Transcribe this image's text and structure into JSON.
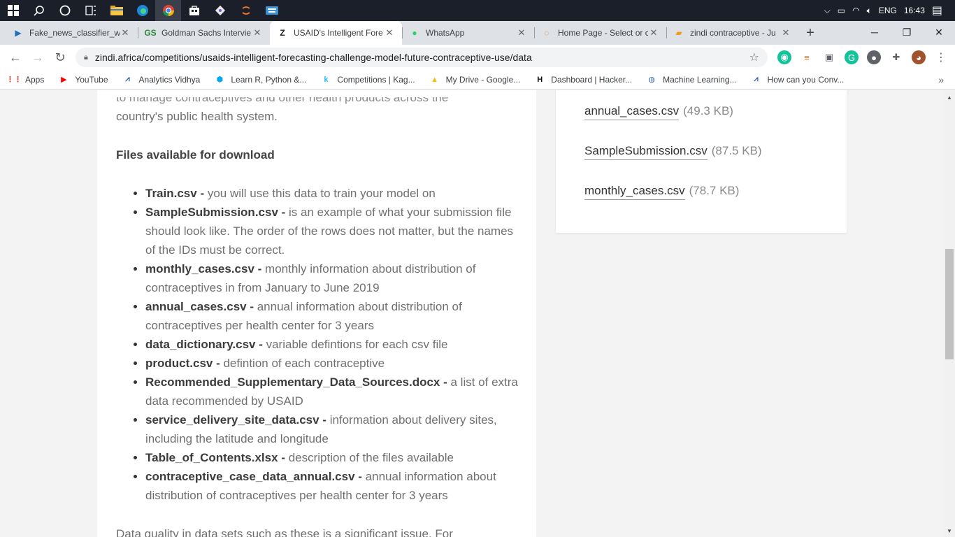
{
  "taskbar": {
    "icons": [
      "windows-start-icon",
      "search-icon",
      "cortana-icon",
      "task-view-icon",
      "file-explorer-icon",
      "edge-icon",
      "chrome-icon",
      "store-icon",
      "git-icon",
      "jupyter-icon",
      "keyboard-icon"
    ],
    "tray": {
      "language": "ENG",
      "time": "16:43"
    }
  },
  "tabs": [
    {
      "title": "Fake_news_classifier_wi",
      "favicon_color": "#1f6fbf",
      "favicon": "▶",
      "active": false
    },
    {
      "title": "Goldman Sachs Intervie",
      "favicon_color": "#2e8b3a",
      "favicon": "GS",
      "active": false
    },
    {
      "title": "USAID's Intelligent Fore",
      "favicon_color": "#202124",
      "favicon": "Z",
      "active": true
    },
    {
      "title": "WhatsApp",
      "favicon_color": "#25d366",
      "favicon": "●",
      "active": false
    },
    {
      "title": "Home Page - Select or c",
      "favicon_color": "#e8743b",
      "favicon": "◌",
      "active": false
    },
    {
      "title": "zindi contraceptive - Ju",
      "favicon_color": "#f39c12",
      "favicon": "▰",
      "active": false
    }
  ],
  "toolbar": {
    "url": "zindi.africa/competitions/usaids-intelligent-forecasting-challenge-model-future-contraceptive-use/data"
  },
  "bookmarks": [
    {
      "label": "Apps",
      "icon": "apps-grid-icon",
      "color": "#ea4335",
      "glyph": "⋮⋮"
    },
    {
      "label": "YouTube",
      "icon": "youtube-icon",
      "color": "#ff0000",
      "glyph": "▶"
    },
    {
      "label": "Analytics Vidhya",
      "icon": "analytics-vidhya-icon",
      "color": "#2a5caa",
      "glyph": "⩘"
    },
    {
      "label": "Learn R, Python &...",
      "icon": "datacamp-icon",
      "color": "#03a9f4",
      "glyph": "⬢"
    },
    {
      "label": "Competitions | Kag...",
      "icon": "kaggle-icon",
      "color": "#20beff",
      "glyph": "k"
    },
    {
      "label": "My Drive - Google...",
      "icon": "google-drive-icon",
      "color": "#fbbc04",
      "glyph": "▲"
    },
    {
      "label": "Dashboard | Hacker...",
      "icon": "hackerrank-icon",
      "color": "#111111",
      "glyph": "H"
    },
    {
      "label": "Machine Learning...",
      "icon": "ml-globe-icon",
      "color": "#4a6fa5",
      "glyph": "◍"
    },
    {
      "label": "How can you Conv...",
      "icon": "analytics-vidhya-icon",
      "color": "#2a5caa",
      "glyph": "⩘"
    }
  ],
  "main": {
    "intro_clipped": "to manage contraceptives and other health products across the",
    "intro_last": "country's public health system.",
    "files_heading": "Files available for download",
    "files": [
      {
        "name": "Train.csv",
        "sep": " - ",
        "desc": "you will use this data to train your model on"
      },
      {
        "name": "SampleSubmission.csv",
        "sep": " - ",
        "desc": "is an example of what your submission file should look like. The order of the rows does not matter, but the names of the IDs must be correct."
      },
      {
        "name": "monthly_cases.csv",
        "sep": " - ",
        "desc": "monthly information about distribution of contraceptives in from January to June 2019"
      },
      {
        "name": "annual_cases.csv",
        "sep": " - ",
        "desc": "annual information about distribution of contraceptives per health center for 3 years"
      },
      {
        "name": "data_dictionary.csv",
        "sep": " - ",
        "desc": "variable defintions for each csv file"
      },
      {
        "name": "product.csv",
        "sep": " - ",
        "desc": "defintion of each contraceptive"
      },
      {
        "name": "Recommended_Supplementary_Data_Sources.docx",
        "sep": " - ",
        "desc": "a list of extra data recommended by USAID"
      },
      {
        "name": "service_delivery_site_data.csv",
        "sep": " - ",
        "desc": "information about delivery sites, including the latitude and longitude"
      },
      {
        "name": "Table_of_Contents.xlsx",
        "sep": " - ",
        "desc": "description of the files available"
      },
      {
        "name": "contraceptive_case_data_annual.csv",
        "sep": " - ",
        "desc": "annual information about distribution of contraceptives per health center for 3 years"
      }
    ],
    "after_text": "Data quality in data sets such as these is a significant issue. For"
  },
  "sidebar": {
    "downloads": [
      {
        "name": "annual_cases.csv",
        "size": "(49.3 KB)"
      },
      {
        "name": "SampleSubmission.csv",
        "size": "(87.5 KB)"
      },
      {
        "name": "monthly_cases.csv",
        "size": "(78.7 KB)"
      }
    ]
  }
}
